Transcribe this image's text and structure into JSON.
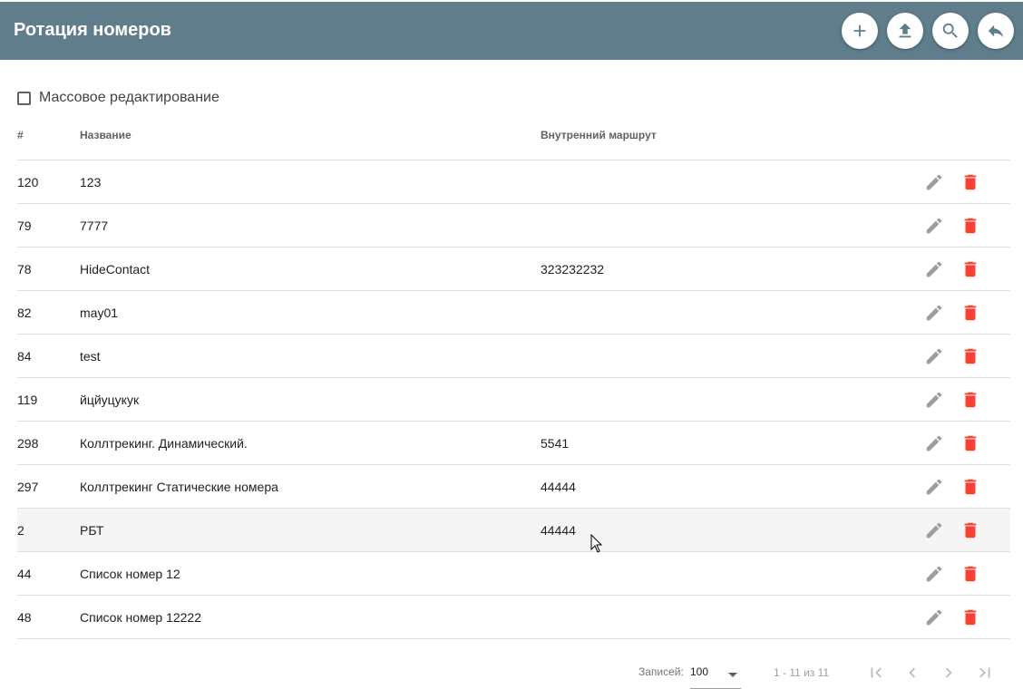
{
  "header": {
    "title": "Ротация номеров",
    "actions": [
      {
        "icon": "add-icon"
      },
      {
        "icon": "upload-icon"
      },
      {
        "icon": "search-icon"
      },
      {
        "icon": "back-icon"
      }
    ],
    "bg_color": "#607d8b"
  },
  "mass_edit": {
    "label": "Массовое редактирование",
    "checked": false
  },
  "table": {
    "columns": [
      "#",
      "Название",
      "Внутренний маршрут"
    ],
    "rows": [
      {
        "id": "120",
        "name": "123",
        "route": ""
      },
      {
        "id": "79",
        "name": "7777",
        "route": ""
      },
      {
        "id": "78",
        "name": "HideContact",
        "route": "323232232"
      },
      {
        "id": "82",
        "name": "may01",
        "route": ""
      },
      {
        "id": "84",
        "name": "test",
        "route": ""
      },
      {
        "id": "119",
        "name": "йцйуцукук",
        "route": ""
      },
      {
        "id": "298",
        "name": "Коллтрекинг. Динамический.",
        "route": "5541"
      },
      {
        "id": "297",
        "name": "Коллтрекинг Статические номера",
        "route": "44444"
      },
      {
        "id": "2",
        "name": "РБТ",
        "route": "44444"
      },
      {
        "id": "44",
        "name": "Список номер 12",
        "route": ""
      },
      {
        "id": "48",
        "name": "Список номер 12222",
        "route": ""
      }
    ],
    "row_icons": {
      "edit": "edit-icon",
      "delete": "delete-icon"
    },
    "delete_color": "#f44336"
  },
  "pagination": {
    "records_label": "Записей:",
    "records_value": "100",
    "range": "1 - 11 из 11",
    "icons": [
      "first-page-icon",
      "prev-page-icon",
      "next-page-icon",
      "last-page-icon"
    ]
  }
}
